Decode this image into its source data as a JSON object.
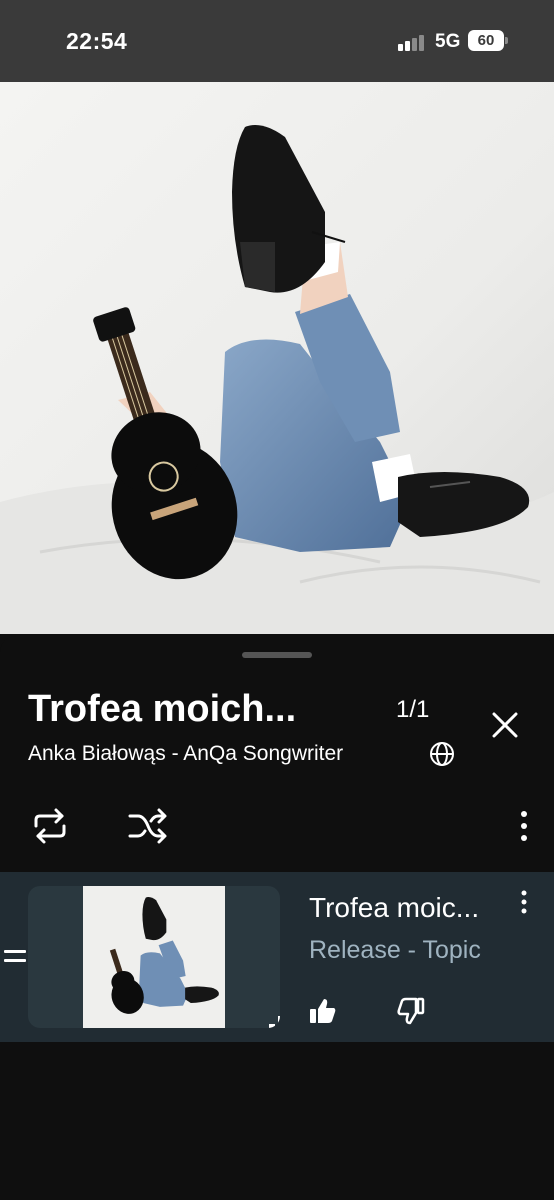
{
  "status_bar": {
    "time": "22:54",
    "network": "5G",
    "battery": "60"
  },
  "queue": {
    "title": "Trofea moich...",
    "count": "1/1",
    "artist": "Anka Białowąs - AnQa Songwriter"
  },
  "queue_items": [
    {
      "title": "Trofea moic...",
      "artist": "Release - Topic"
    }
  ],
  "icons": {
    "close": "close-icon",
    "globe": "globe-icon",
    "repeat": "repeat-icon",
    "shuffle": "shuffle-icon",
    "more": "more-vert-icon",
    "drag": "drag-handle-icon",
    "playing": "equalizer-bars-icon",
    "like": "thumbs-up-icon",
    "dislike": "thumbs-down-icon"
  },
  "colors": {
    "status_bar": "#3a3a3a",
    "sheet": "#0f0f0f",
    "queue_item": "#212c33",
    "secondary_text": "#9fb3c0"
  }
}
